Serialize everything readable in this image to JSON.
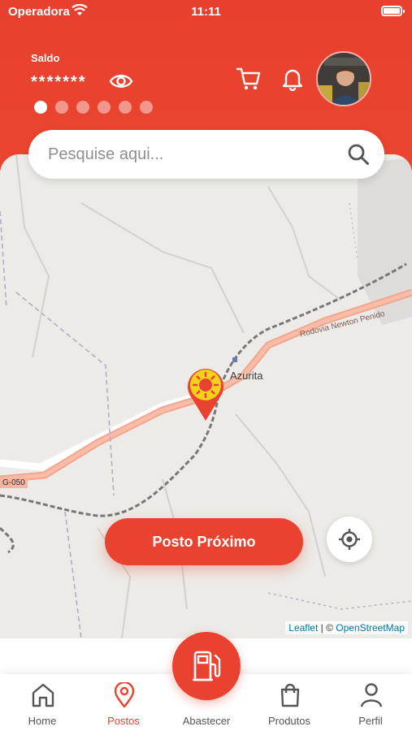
{
  "status_bar": {
    "carrier": "Operadora",
    "time": "11:11"
  },
  "header": {
    "saldo_label": "Saldo",
    "saldo_value": "*******",
    "carousel_pages": 6,
    "carousel_active": 1
  },
  "search": {
    "placeholder": "Pesquise aqui..."
  },
  "map": {
    "town": "Azurita",
    "road": "Rodovia Newton Penido",
    "road_code": "G-050",
    "attribution": {
      "leaflet": "Leaflet",
      "separator": " | © ",
      "osm": "OpenStreetMap"
    }
  },
  "actions": {
    "nearest_station": "Posto Próximo"
  },
  "tabs": {
    "home": "Home",
    "postos": "Postos",
    "abastecer": "Abastecer",
    "produtos": "Produtos",
    "perfil": "Perfil"
  },
  "colors": {
    "accent": "#ea4230",
    "map_bg": "#ecebe7",
    "road": "#f5a890"
  },
  "icons": [
    "wifi-icon",
    "eye-icon",
    "cart-icon",
    "bell-icon",
    "search-icon",
    "fuel-pump-icon",
    "location-pin-icon",
    "home-icon",
    "user-icon",
    "bag-icon",
    "crosshair-icon"
  ]
}
